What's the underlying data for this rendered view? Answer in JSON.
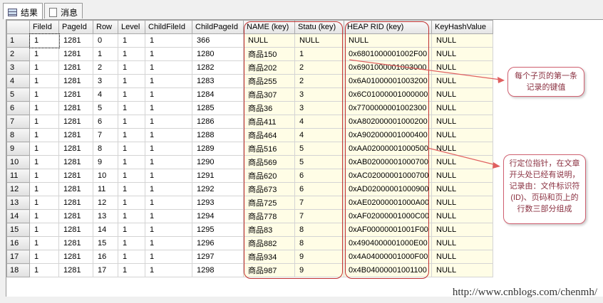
{
  "tabs": [
    {
      "label": "结果",
      "icon": "grid-icon"
    },
    {
      "label": "消息",
      "icon": "message-icon"
    }
  ],
  "columns": [
    "FileId",
    "PageId",
    "Row",
    "Level",
    "ChildFileId",
    "ChildPageId",
    "NAME (key)",
    "Statu (key)",
    "HEAP RID (key)",
    "KeyHashValue"
  ],
  "rows": [
    [
      "1",
      "1281",
      "0",
      "1",
      "1",
      "366",
      "NULL",
      "NULL",
      "NULL",
      "NULL"
    ],
    [
      "1",
      "1281",
      "1",
      "1",
      "1",
      "1280",
      "商品150",
      "1",
      "0x6801000001002F00",
      "NULL"
    ],
    [
      "1",
      "1281",
      "2",
      "1",
      "1",
      "1282",
      "商品202",
      "2",
      "0x6901000001003000",
      "NULL"
    ],
    [
      "1",
      "1281",
      "3",
      "1",
      "1",
      "1283",
      "商品255",
      "2",
      "0x6A01000001003200",
      "NULL"
    ],
    [
      "1",
      "1281",
      "4",
      "1",
      "1",
      "1284",
      "商品307",
      "3",
      "0x6C01000001000000",
      "NULL"
    ],
    [
      "1",
      "1281",
      "5",
      "1",
      "1",
      "1285",
      "商品36",
      "3",
      "0x7700000001002300",
      "NULL"
    ],
    [
      "1",
      "1281",
      "6",
      "1",
      "1",
      "1286",
      "商品411",
      "4",
      "0xA802000001000200",
      "NULL"
    ],
    [
      "1",
      "1281",
      "7",
      "1",
      "1",
      "1288",
      "商品464",
      "4",
      "0xA902000001000400",
      "NULL"
    ],
    [
      "1",
      "1281",
      "8",
      "1",
      "1",
      "1289",
      "商品516",
      "5",
      "0xAA02000001000500",
      "NULL"
    ],
    [
      "1",
      "1281",
      "9",
      "1",
      "1",
      "1290",
      "商品569",
      "5",
      "0xAB02000001000700",
      "NULL"
    ],
    [
      "1",
      "1281",
      "10",
      "1",
      "1",
      "1291",
      "商品620",
      "6",
      "0xAC02000001000700",
      "NULL"
    ],
    [
      "1",
      "1281",
      "11",
      "1",
      "1",
      "1292",
      "商品673",
      "6",
      "0xAD02000001000900",
      "NULL"
    ],
    [
      "1",
      "1281",
      "12",
      "1",
      "1",
      "1293",
      "商品725",
      "7",
      "0xAE02000001000A00",
      "NULL"
    ],
    [
      "1",
      "1281",
      "13",
      "1",
      "1",
      "1294",
      "商品778",
      "7",
      "0xAF02000001000C00",
      "NULL"
    ],
    [
      "1",
      "1281",
      "14",
      "1",
      "1",
      "1295",
      "商品83",
      "8",
      "0xAF00000001001F00",
      "NULL"
    ],
    [
      "1",
      "1281",
      "15",
      "1",
      "1",
      "1296",
      "商品882",
      "8",
      "0x4904000001000E00",
      "NULL"
    ],
    [
      "1",
      "1281",
      "16",
      "1",
      "1",
      "1297",
      "商品934",
      "9",
      "0x4A04000001000F00",
      "NULL"
    ],
    [
      "1",
      "1281",
      "17",
      "1",
      "1",
      "1298",
      "商品987",
      "9",
      "0x4B04000001001100",
      "NULL"
    ]
  ],
  "callouts": {
    "key_note": "每个子页的第一条记录的键值",
    "rid_note": "行定位指针，在文章开头处已经有说明，记录由：文件标识符(ID)、页码和页上的行数三部分组成"
  },
  "watermark": "http://www.cnblogs.com/chenmh/",
  "colors": {
    "key_column_bg": "#fffde6",
    "annotation_red": "#c03030"
  }
}
